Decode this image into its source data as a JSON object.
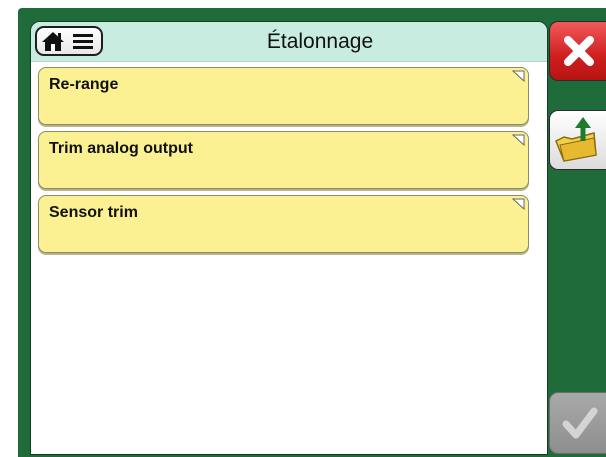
{
  "app": {
    "title": "Étalonnage"
  },
  "menu": {
    "items": [
      {
        "label": "Re-range"
      },
      {
        "label": "Trim analog output"
      },
      {
        "label": "Sensor trim"
      }
    ]
  },
  "buttons": {
    "home_icon": "home-icon",
    "menu_icon": "hamburger-menu-icon",
    "close_icon": "close-x-icon",
    "folder_icon": "folder-up-arrow-icon",
    "confirm_icon": "checkmark-icon",
    "confirm_enabled": false
  },
  "colors": {
    "frame": "#1f6b3a",
    "titlebar": "#c9ece1",
    "menu_item": "#fbf193",
    "close_button": "#cf1e1e"
  }
}
